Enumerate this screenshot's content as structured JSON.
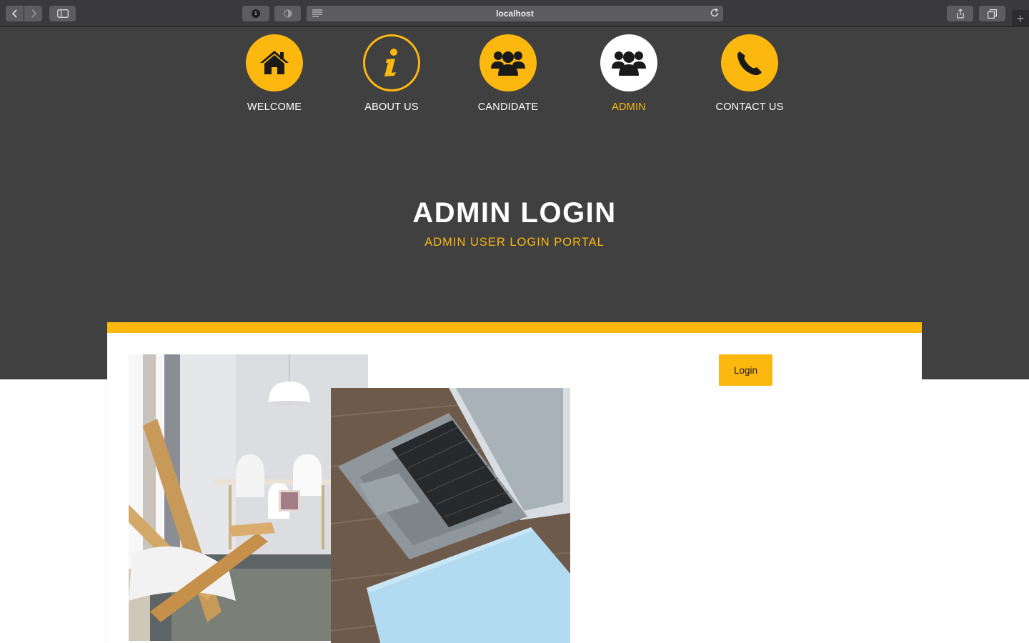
{
  "browser": {
    "url": "localhost",
    "extension_badge": "1"
  },
  "nav": {
    "items": [
      {
        "label": "WELCOME",
        "icon": "home-icon"
      },
      {
        "label": "ABOUT US",
        "icon": "info-icon"
      },
      {
        "label": "CANDIDATE",
        "icon": "users-icon"
      },
      {
        "label": "ADMIN",
        "icon": "users-icon",
        "active": true
      },
      {
        "label": "CONTACT US",
        "icon": "phone-icon"
      }
    ]
  },
  "hero": {
    "title": "ADMIN LOGIN",
    "subtitle": "ADMIN USER LOGIN PORTAL"
  },
  "login": {
    "button_label": "Login"
  },
  "colors": {
    "accent": "#fdb810",
    "hero_background": "#404040",
    "card_background": "#ffffff"
  }
}
